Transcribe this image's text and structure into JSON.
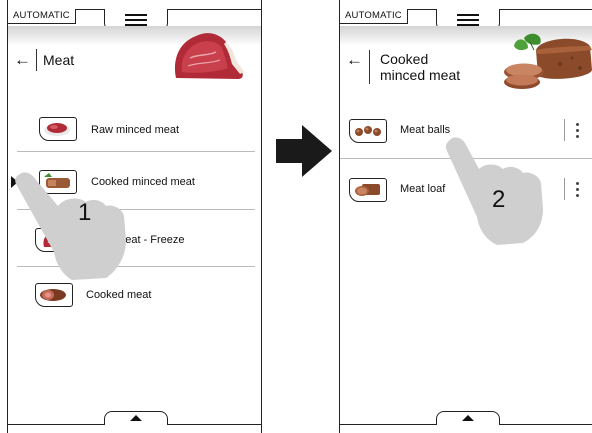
{
  "left_screen": {
    "mode_label": "AUTOMATIC",
    "title": "Meat",
    "items": [
      {
        "label": "Raw minced meat",
        "selected": false,
        "icon": "raw-minced-meat-icon"
      },
      {
        "label": "Cooked minced meat",
        "selected": true,
        "icon": "cooked-minced-meat-icon"
      },
      {
        "label": "Raw meat - Freeze",
        "selected": false,
        "icon": "raw-meat-freeze-icon"
      },
      {
        "label": "Cooked meat",
        "selected": false,
        "icon": "cooked-meat-icon"
      }
    ],
    "header_image": "raw-steak-image",
    "step_number": "1"
  },
  "right_screen": {
    "mode_label": "AUTOMATIC",
    "title_line1": "Cooked",
    "title_line2": "minced meat",
    "items": [
      {
        "label": "Meat balls",
        "icon": "meat-balls-icon"
      },
      {
        "label": "Meat loaf",
        "icon": "meat-loaf-icon"
      }
    ],
    "header_image": "meatloaf-image",
    "step_number": "2"
  },
  "icons": {
    "menu": "hamburger-menu-icon",
    "back": "back-arrow-icon",
    "options": "kebab-menu-icon",
    "expand": "chevron-up-icon",
    "transition": "right-arrow-icon"
  },
  "colors": {
    "frame": "#222222",
    "hand": "#cfcfcf",
    "meat_raw": "#b02a37",
    "meat_cooked": "#9a5a38",
    "herb": "#3e8e2e"
  }
}
